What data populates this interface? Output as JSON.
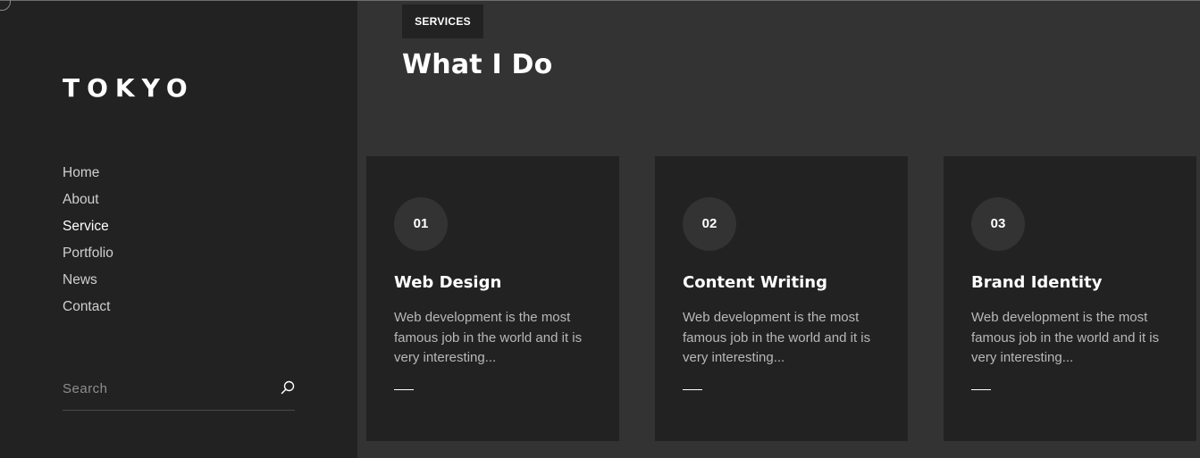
{
  "sidebar": {
    "logo": "TOKYO",
    "nav": [
      "Home",
      "About",
      "Service",
      "Portfolio",
      "News",
      "Contact"
    ],
    "active_nav": "Service",
    "search": {
      "placeholder": "Search",
      "icon": "search-icon"
    }
  },
  "main": {
    "badge": "SERVICES",
    "heading": "What I Do",
    "cards": [
      {
        "number": "01",
        "title": "Web Design",
        "description": "Web development is the most famous job in the world and it is very interesting..."
      },
      {
        "number": "02",
        "title": "Content Writing",
        "description": "Web development is the most famous job in the world and it is very interesting..."
      },
      {
        "number": "03",
        "title": "Brand Identity",
        "description": "Web development is the most famous job in the world and it is very interesting..."
      }
    ]
  },
  "colors": {
    "sidebar_bg": "#222222",
    "main_bg": "#333333",
    "card_bg": "#222222",
    "text_primary": "#ffffff",
    "text_muted": "#b8b8b8"
  }
}
